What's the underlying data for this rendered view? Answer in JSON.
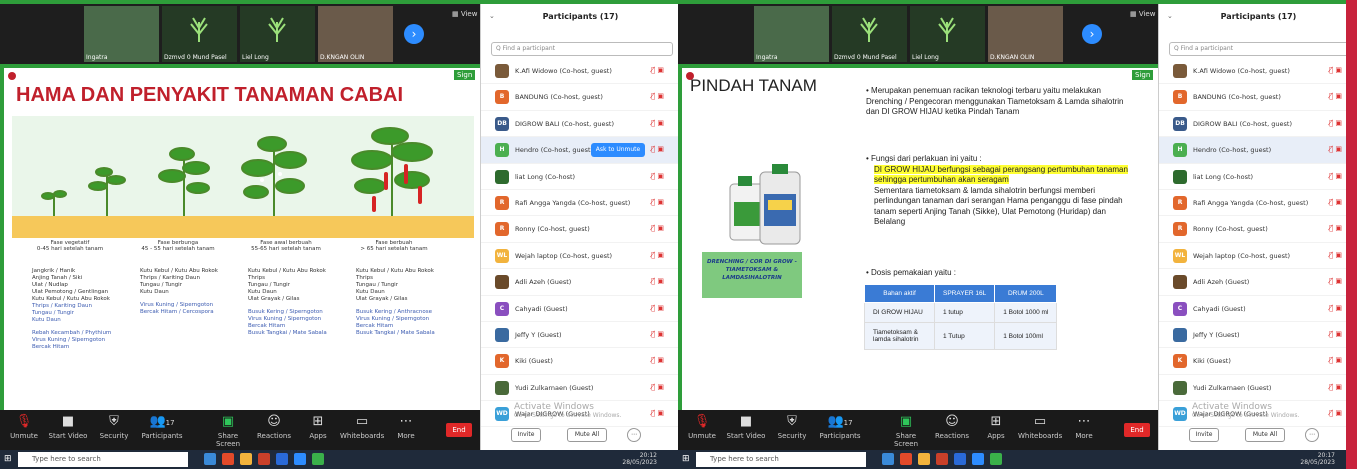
{
  "colors": {
    "accent": "#2e9d3a",
    "zoom_blue": "#2d8cff",
    "end_red": "#e02828",
    "title_red": "#c0202c"
  },
  "video_strip": {
    "names": [
      "Ingatra",
      "Dzmvd 0 Mund Pasel",
      "Liel Long",
      "D.KNGAN OLIN"
    ],
    "view": "View"
  },
  "zoom_toolbar": {
    "items": [
      "Unmute",
      "Start Video",
      "Security",
      "Participants",
      "Share Screen",
      "Reactions",
      "Apps",
      "Whiteboards",
      "More"
    ],
    "participants_count": "17",
    "end": "End"
  },
  "left": {
    "slide_title": "HAMA DAN PENYAKIT TANAMAN CABAI",
    "sign": "Sign",
    "phases": [
      {
        "name": "Fase vegetatif",
        "days": "0-45 hari setelah tanam",
        "pests": [
          "Jangkrik / Hanik",
          "Anjing Tanah / Siki",
          "Ulat / Nudlap",
          "Ulat Pemotong / Gentlingan",
          "Kutu Kebul / Kutu Abu Rokok",
          "Thrips / Kariting Daun",
          "Tungau / Tungir",
          "Kutu Daun",
          "",
          "Rebah Kecambah / Phythium",
          "Virus Kuning / Siperngoton",
          "Bercak Hitam"
        ]
      },
      {
        "name": "Fase berbunga",
        "days": "45 - 55 hari setelah tanam",
        "pests": [
          "Kutu Kebul / Kutu Abu Rokok",
          "Thrips / Kariting Daun",
          "Tungau / Tungir",
          "Kutu Daun",
          "",
          "Virus Kuning / Siperngoton",
          "Bercak Hitam / Cercospora"
        ]
      },
      {
        "name": "Fase awal berbuah",
        "days": "55-65 hari setelah tanam",
        "pests": [
          "Kutu Kebul / Kutu Abu Rokok",
          "Thrips",
          "Tungau / Tungir",
          "Kutu Daun",
          "Ulat Grayak / Gilas",
          "",
          "Busuk Kering / Siperngoton",
          "Virus Kuning / Siperngoton",
          "Bercak Hitam",
          "Busuk Tangkai / Mate Sabala"
        ]
      },
      {
        "name": "Fase berbuah",
        "days": "> 65 hari setelah tanam",
        "pests": [
          "Kutu Kebul / Kutu Abu Rokok",
          "Thrips",
          "Tungau / Tungir",
          "Kutu Daun",
          "Ulat Grayak / Gilas",
          "",
          "Busuk Kering / Anthracnose",
          "Virus Kuning / Siperngoton",
          "Bercak Hitam",
          "Busuk Tangkai / Mate Sabala"
        ]
      }
    ],
    "participants_title": "Participants (17)",
    "search_placeholder": "Q Find a participant",
    "participants": [
      {
        "initial": "",
        "name": "K.Afi Widowo (Co-host, guest)",
        "color": "#7a5a3a"
      },
      {
        "initial": "B",
        "name": "BANDUNG (Co-host, guest)",
        "color": "#e2672c"
      },
      {
        "initial": "DB",
        "name": "DIGROW BALI (Co-host, guest)",
        "color": "#3a5a8a"
      },
      {
        "initial": "H",
        "name": "Hendro (Co-host, guest)",
        "color": "#4caf50"
      },
      {
        "initial": "",
        "name": "liat Long (Co-host)",
        "color": "#2e6b2e"
      },
      {
        "initial": "R",
        "name": "Rafi Angga Yangda (Co-host, guest)",
        "color": "#e2672c"
      },
      {
        "initial": "R",
        "name": "Ronny (Co-host, guest)",
        "color": "#e2672c"
      },
      {
        "initial": "WL",
        "name": "Wejah laptop (Co-host, guest)",
        "color": "#f2b33d"
      },
      {
        "initial": "",
        "name": "Adli Azeh (Guest)",
        "color": "#6a4a2a"
      },
      {
        "initial": "C",
        "name": "Cahyadi (Guest)",
        "color": "#8a4fbf"
      },
      {
        "initial": "",
        "name": "Jeffy Y (Guest)",
        "color": "#3a6aa0"
      },
      {
        "initial": "K",
        "name": "Kiki (Guest)",
        "color": "#e2672c"
      },
      {
        "initial": "",
        "name": "Yudi Zulkarnaen (Guest)",
        "color": "#4a6a3a"
      },
      {
        "initial": "WD",
        "name": "Wajar DIGROW (Guest)",
        "color": "#3aa0d8"
      }
    ],
    "ask_unmute": "Ask to Unmute",
    "invite": "Invite",
    "mute_all": "Mute All",
    "watermark": "Activate Windows",
    "watermark_sub": "Go to Settings to activate Windows."
  },
  "right": {
    "slide_title": "PINDAH TANAM",
    "sign": "Sign",
    "product_caption": "DRENCHING / COR DI GROW - TIAMETOKSAM & LAMDASIHALOTRIN",
    "bullet1": "Merupakan penemuan racikan teknologi terbaru yaitu melakukan Drenching / Pengecoran menggunakan Tiametoksam & Lamda sihalotrin dan DI GROW HIJAU ketika Pindah Tanam",
    "bullet2_head": "Fungsi dari perlakuan ini yaitu :",
    "bullet2_a": "DI GROW HIJAU berfungsi sebagai perangsang pertumbuhan tanaman sehingga pertumbuhan akan seragam",
    "bullet2_b": "Sementara tiametoksam & lamda sihalotrin berfungsi memberi perlindungan tanaman dari serangan Hama penganggu di fase pindah tanam seperti Anjing Tanah (Sikke), Ulat Pemotong (Huridap) dan Belalang",
    "bullet3": "Dosis pemakaian yaitu :",
    "table": {
      "headers": [
        "Bahan aktif",
        "SPRAYER 16L",
        "DRUM 200L"
      ],
      "rows": [
        [
          "DI GROW HIJAU",
          "1 tutup",
          "1 Botol 1000 ml"
        ],
        [
          "Tiametoksam & lamda sihalotrin",
          "1 Tutup",
          "1 Botol 100ml"
        ]
      ]
    },
    "participants_title": "Participants (17)",
    "search_placeholder": "Q Find a participant",
    "participants": [
      {
        "initial": "",
        "name": "K.Afi Widowo (Co-host, guest)",
        "color": "#7a5a3a"
      },
      {
        "initial": "B",
        "name": "BANDUNG (Co-host, guest)",
        "color": "#e2672c"
      },
      {
        "initial": "DB",
        "name": "DIGROW BALI (Co-host, guest)",
        "color": "#3a5a8a"
      },
      {
        "initial": "H",
        "name": "Hendro (Co-host, guest)",
        "color": "#4caf50"
      },
      {
        "initial": "",
        "name": "liat Long (Co-host)",
        "color": "#2e6b2e"
      },
      {
        "initial": "R",
        "name": "Rafi Angga Yangda (Co-host, guest)",
        "color": "#e2672c"
      },
      {
        "initial": "R",
        "name": "Ronny (Co-host, guest)",
        "color": "#e2672c"
      },
      {
        "initial": "WL",
        "name": "Wejah laptop (Co-host, guest)",
        "color": "#f2b33d"
      },
      {
        "initial": "",
        "name": "Adli Azeh (Guest)",
        "color": "#6a4a2a"
      },
      {
        "initial": "C",
        "name": "Cahyadi (Guest)",
        "color": "#8a4fbf"
      },
      {
        "initial": "",
        "name": "Jeffy Y (Guest)",
        "color": "#3a6aa0"
      },
      {
        "initial": "K",
        "name": "Kiki (Guest)",
        "color": "#e2672c"
      },
      {
        "initial": "",
        "name": "Yudi Zulkarnaen (Guest)",
        "color": "#4a6a3a"
      },
      {
        "initial": "WD",
        "name": "Wajar DIGROW (Guest)",
        "color": "#3aa0d8"
      }
    ],
    "invite": "Invite",
    "mute_all": "Mute All",
    "watermark": "Activate Windows",
    "watermark_sub": "Go to Settings to activate Windows."
  },
  "taskbar": {
    "search_placeholder": "Type here to search",
    "time_left": "20:12",
    "date_left": "28/05/2023",
    "time_right": "20:17",
    "date_right": "28/05/2023"
  }
}
